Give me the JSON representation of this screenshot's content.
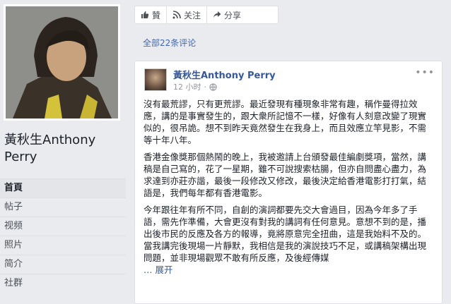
{
  "sidebar": {
    "page_name": "黃秋生Anthony Perry",
    "nav": [
      {
        "label": "首頁",
        "active": true
      },
      {
        "label": "帖子"
      },
      {
        "label": "视频"
      },
      {
        "label": "照片"
      },
      {
        "label": "简介"
      },
      {
        "label": "社群"
      }
    ]
  },
  "actions": {
    "like": "贊",
    "follow": "关注",
    "share": "分享"
  },
  "comments_link": "全部22条评论",
  "post": {
    "author": "黃秋生Anthony Perry",
    "time": "12 小时",
    "paragraphs": [
      "沒有最荒謬，只有更荒謬。最近發現有種現象非常有趣，稱作曼得拉效應，講的是事實發生的，跟大衆所記憶不一樣，好像有人刻意改變了現實似的，很吊詭。想不到昨天竟然發生在我身上，而且效應立竿見影，不需等十年八年。",
      "香港金像獎那個熱鬧的晚上，我被邀請上台頒發最佳編劇獎項，當然，講稿是自己寫的，花了一星期，雖不可說搜索枯腸，但亦自問盡心盡力，為求達到亦莊亦諧，最後一段修改又修改，最後決定給香港電影打打氣，結語是，我們每年都有香港電影。",
      "今年跟往年有所不同，自創的演詞都要先交大會過目，因為今年多了手語，需先作準備，大會更沒有對我的講詞有任何意見。意想不到的是，播出後市民的反應及各方的報導，竟將原意完全扭曲，這是我始料不及的。 當我講完後現場一片靜默，我相信是我的演說技巧不足，或講稿架構出現問題，並非現場觀眾不敢有所反應，及後經傳媒"
    ],
    "see_more": "… 展开"
  }
}
